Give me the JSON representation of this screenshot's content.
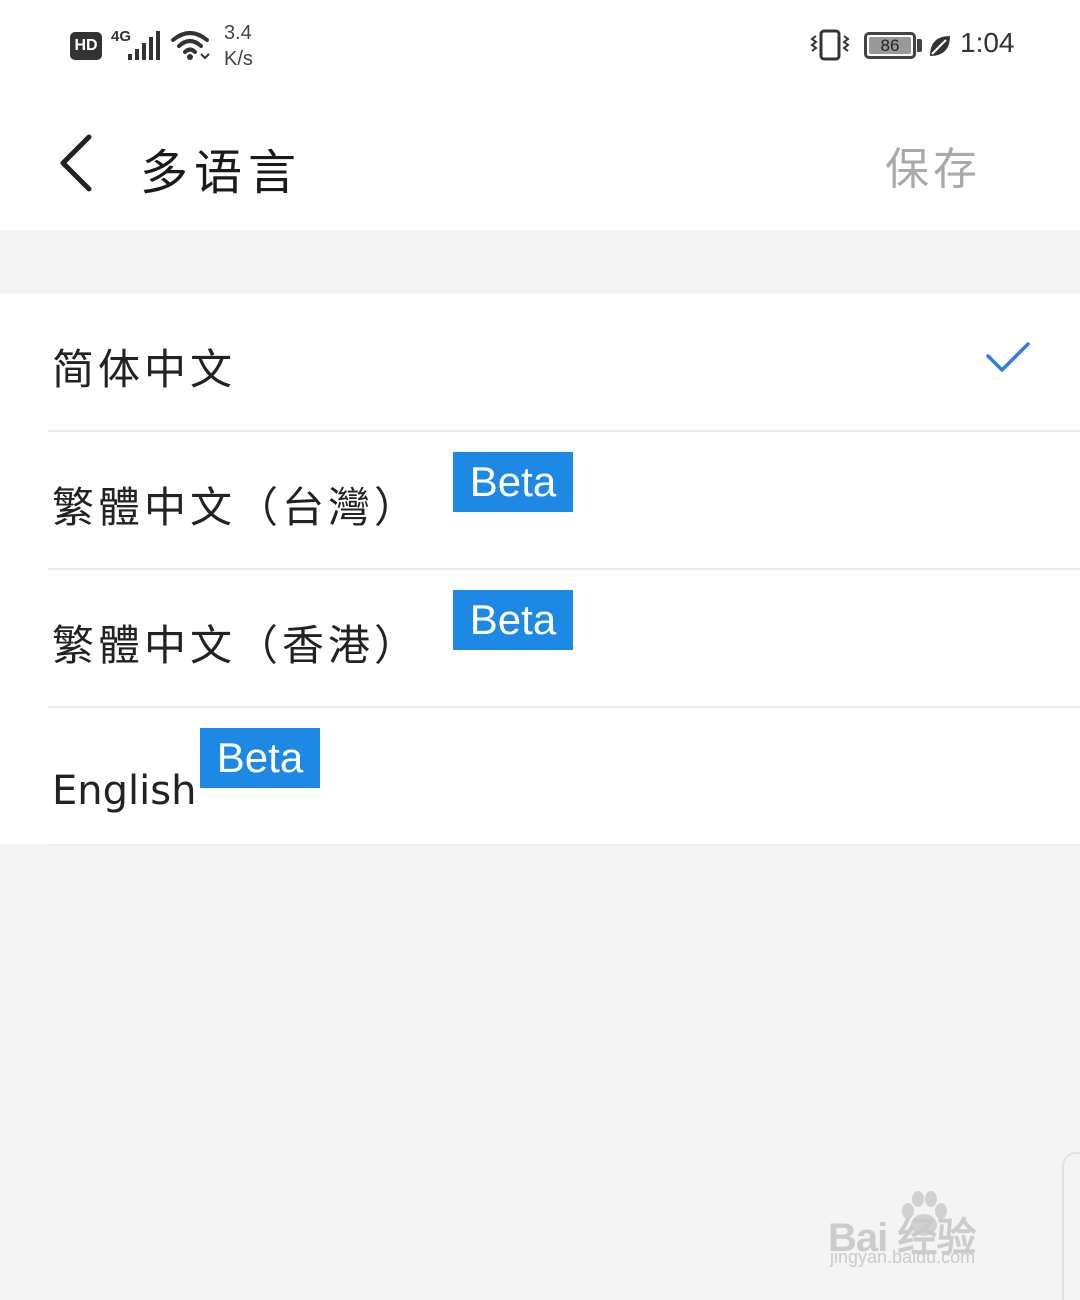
{
  "status_bar": {
    "hd": "HD",
    "network": "4G",
    "speed_value": "3.4",
    "speed_unit": "K/s",
    "battery": "86",
    "time": "1:04",
    "icons": [
      "hd-icon",
      "signal-icon",
      "wifi-icon",
      "vibrate-icon",
      "battery-icon",
      "leaf-icon"
    ]
  },
  "header": {
    "title": "多语言",
    "save_label": "保存",
    "back_icon": "chevron-left-icon"
  },
  "languages": [
    {
      "label": "简体中文",
      "selected": true,
      "beta": ""
    },
    {
      "label": "繁體中文（台灣）",
      "selected": false,
      "beta": "Beta"
    },
    {
      "label": "繁體中文（香港）",
      "selected": false,
      "beta": "Beta"
    },
    {
      "label": "English",
      "selected": false,
      "beta": "Beta"
    }
  ],
  "watermark": {
    "logo": "Bai  经验",
    "url": "jingyan.baidu.com"
  },
  "colors": {
    "accent": "#1e88e5",
    "check": "#2f7fd6",
    "save_disabled": "#a9a9a9",
    "background": "#f4f4f4"
  }
}
